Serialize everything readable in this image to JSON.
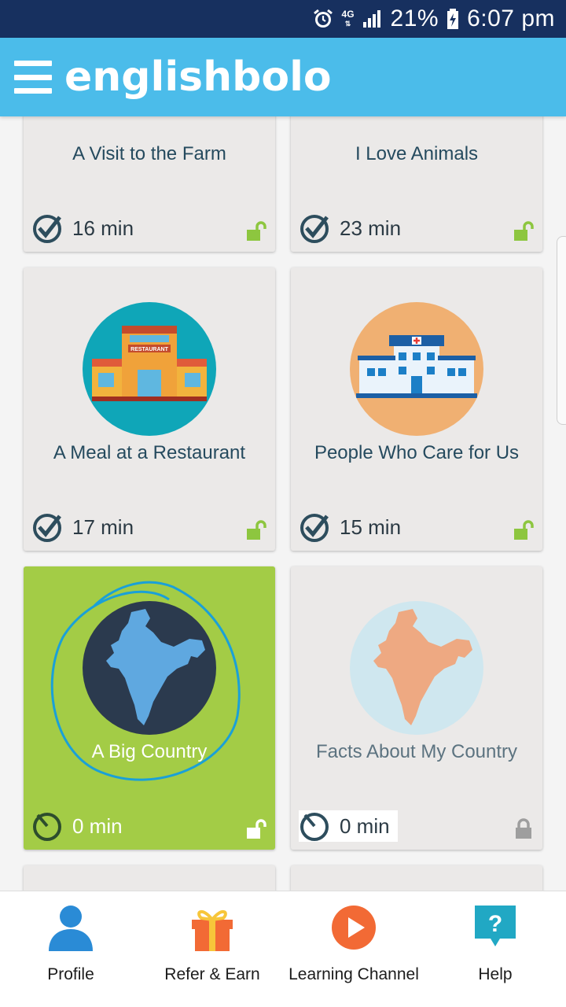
{
  "status_bar": {
    "signal": "4G",
    "battery": "21%",
    "time": "6:07 pm"
  },
  "app_bar": {
    "logo": "englishbolo"
  },
  "lessons": [
    {
      "title": "A Visit to the Farm",
      "duration": "16 min",
      "state": "unlocked-done"
    },
    {
      "title": "I Love Animals",
      "duration": "23 min",
      "state": "unlocked-done"
    },
    {
      "title": "A Meal at a Restaurant",
      "duration": "17 min",
      "state": "unlocked-done"
    },
    {
      "title": "People Who Care for Us",
      "duration": "15 min",
      "state": "unlocked-done"
    },
    {
      "title": "A Big Country",
      "duration": "0 min",
      "state": "active"
    },
    {
      "title": "Facts About My Country",
      "duration": "0 min",
      "state": "locked"
    }
  ],
  "restaurant_sign": "RESTAURANT",
  "bottom_nav": [
    {
      "label": "Profile",
      "icon": "profile-icon"
    },
    {
      "label": "Refer & Earn",
      "icon": "gift-icon"
    },
    {
      "label": "Learning Channel",
      "icon": "play-icon"
    },
    {
      "label": "Help",
      "icon": "help-icon"
    }
  ],
  "colors": {
    "status_bar": "#17305f",
    "app_bar": "#4bbcea",
    "active_card": "#a3cc46",
    "unlock_green": "#8dc63f",
    "lock_gray": "#9e9e9e"
  }
}
